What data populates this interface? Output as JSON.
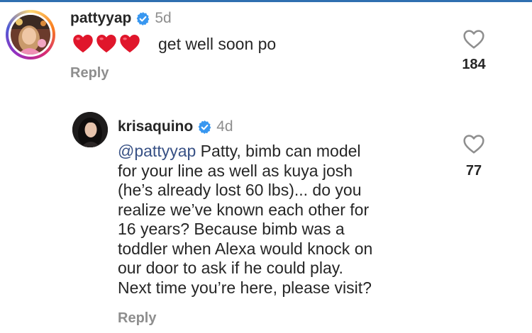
{
  "comment": {
    "username": "pattyyap",
    "timestamp": "5d",
    "emoji": "❤️❤️❤️",
    "text": "get well soon po",
    "reply_label": "Reply",
    "like_count": "184"
  },
  "reply": {
    "username": "krisaquino",
    "timestamp": "4d",
    "mention": "@pattyyap",
    "lines": [
      " Patty, bimb can model",
      "for your line as well as kuya josh",
      "(he’s already lost 60 lbs)... do you",
      "realize we’ve known each other for",
      "16 years? Because bimb was a",
      "toddler when Alexa would knock on",
      "our door to ask if he could play.",
      "Next time you’re here, please visit?"
    ],
    "reply_label": "Reply",
    "like_count": "77"
  },
  "colors": {
    "verified_badge": "#3897f0",
    "heart_emoji": "#e0162b",
    "secondary_text": "#8e8e8e",
    "mention": "#385185"
  },
  "icons": {
    "verified": "verified-badge-icon",
    "like": "heart-outline-icon"
  }
}
